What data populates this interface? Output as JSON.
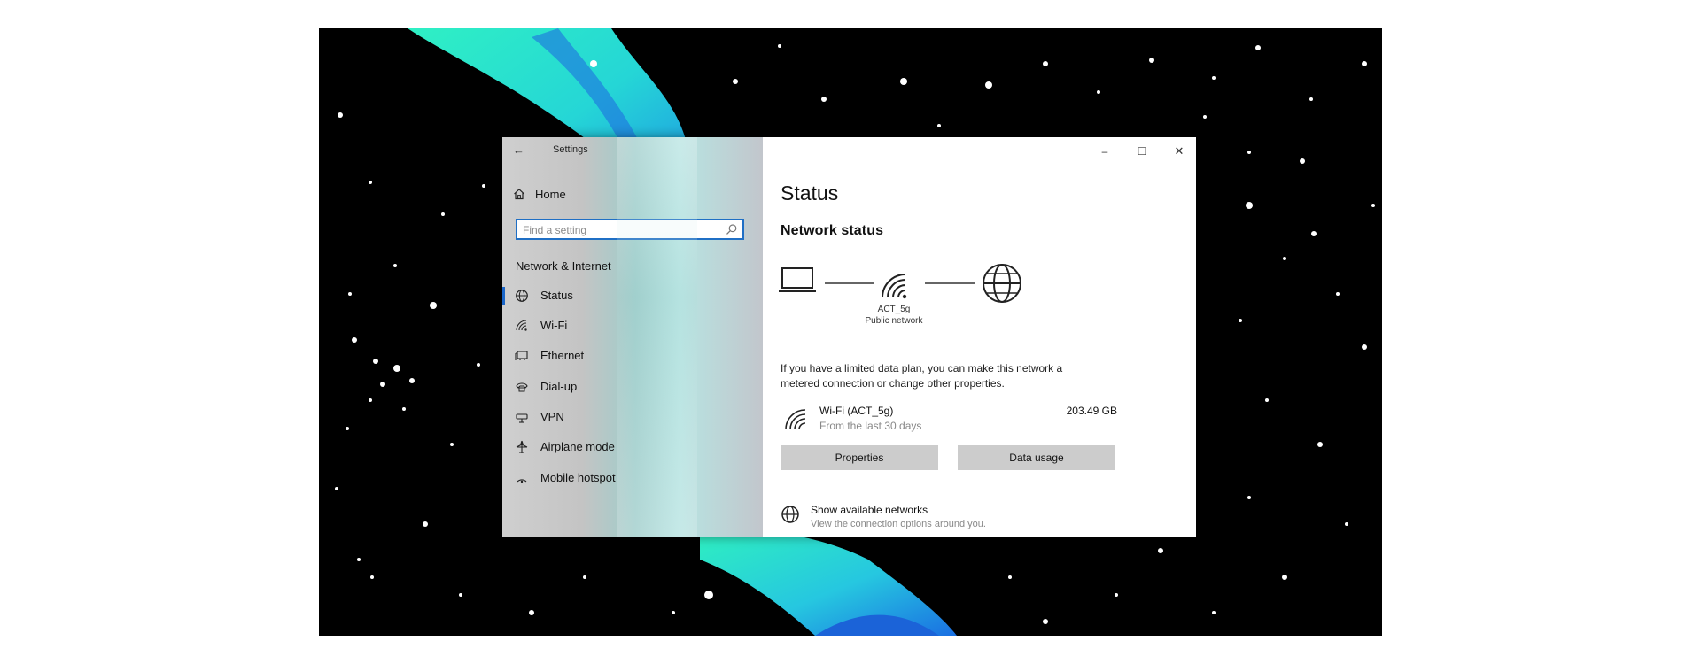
{
  "window": {
    "app_title": "Settings",
    "back_glyph": "←",
    "controls": {
      "minimize": "–",
      "maximize": "☐",
      "close": "✕"
    }
  },
  "sidebar": {
    "home_label": "Home",
    "search_placeholder": "Find a setting",
    "section_heading": "Network & Internet",
    "items": [
      {
        "label": "Status",
        "icon": "status-globe-icon",
        "active": true
      },
      {
        "label": "Wi-Fi",
        "icon": "wifi-icon",
        "active": false
      },
      {
        "label": "Ethernet",
        "icon": "ethernet-icon",
        "active": false
      },
      {
        "label": "Dial-up",
        "icon": "dialup-icon",
        "active": false
      },
      {
        "label": "VPN",
        "icon": "vpn-icon",
        "active": false
      },
      {
        "label": "Airplane mode",
        "icon": "airplane-icon",
        "active": false
      },
      {
        "label": "Mobile hotspot",
        "icon": "hotspot-icon",
        "active": false
      }
    ]
  },
  "main": {
    "title": "Status",
    "network_status_heading": "Network status",
    "network_name": "ACT_5g",
    "network_type": "Public network",
    "info_text": "If you have a limited data plan, you can make this network a metered connection or change other properties.",
    "connection": {
      "name": "Wi-Fi (ACT_5g)",
      "subtitle": "From the last 30 days",
      "usage": "203.49 GB"
    },
    "buttons": {
      "properties": "Properties",
      "data_usage": "Data usage"
    },
    "show_networks": {
      "title": "Show available networks",
      "subtitle": "View the connection options around you."
    }
  },
  "colors": {
    "accent": "#1a66c9",
    "button_bg": "#cccccc",
    "wallpaper_teal": "#2de8c8",
    "wallpaper_blue": "#1e7be6"
  }
}
